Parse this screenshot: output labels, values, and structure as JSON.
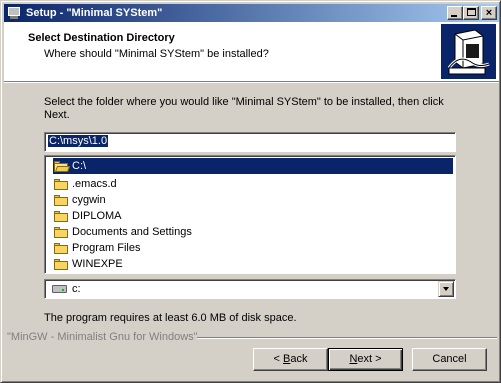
{
  "window": {
    "title": "Setup - \"Minimal SYStem\"",
    "controls": {
      "minimize": "minimize",
      "maximize": "maximize",
      "close": "×"
    }
  },
  "header": {
    "title": "Select Destination Directory",
    "subtitle": "Where should \"Minimal SYStem\" be installed?"
  },
  "prompt": "Select the folder where you would like \"Minimal SYStem\" to be installed, then click Next.",
  "path_value": "C:\\msys\\1.0",
  "tree": {
    "items": [
      {
        "label": "C:\\",
        "selected": true,
        "open": true
      },
      {
        "label": ".emacs.d"
      },
      {
        "label": "cygwin"
      },
      {
        "label": "DIPLOMA"
      },
      {
        "label": "Documents and Settings"
      },
      {
        "label": "Program Files"
      },
      {
        "label": "WINEXPE"
      }
    ]
  },
  "drive": {
    "label": "c:",
    "icon": "hard-drive-icon"
  },
  "space_requirement": "The program requires at least 6.0 MB of disk space.",
  "footer_label": "\"MinGW - Minimalist Gnu for Windows\"",
  "buttons": {
    "back": {
      "prefix": "< ",
      "mnemonic": "B",
      "rest": "ack"
    },
    "next": {
      "mnemonic": "N",
      "rest": "ext >"
    },
    "cancel": "Cancel"
  },
  "colors": {
    "title_bar": "#0a246a",
    "selection": "#0a246a",
    "face": "#d4d0c8"
  }
}
